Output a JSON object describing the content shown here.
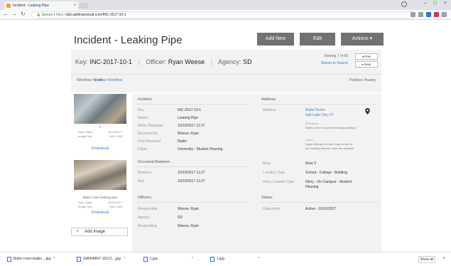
{
  "browser": {
    "tab_title": "Incident - Leaking Pipe",
    "url_secure": "Secure",
    "url_proto": "https://",
    "url": "ally.spillmancloud.com/INC-2017-10-1"
  },
  "page": {
    "title": "Incident - Leaking Pipe",
    "buttons": {
      "add_new": "Add New",
      "edit": "Edit",
      "actions": "Actions ▾"
    },
    "header": {
      "key_label": "Key:",
      "key_value": "INC-2017-10-1",
      "officer_label": "Officer:",
      "officer_value": "Ryan Weese",
      "agency_label": "Agency:",
      "agency_value": "SD",
      "viewing": "Viewing 7 of 66",
      "return": "Return to Search",
      "prev": "◂ Prev",
      "next": "▸ Next",
      "workflow_label": "Workflow:",
      "workflow_value": "None",
      "start_workflow": "Start Workflow",
      "partition": "Partition: Bradey"
    },
    "images": [
      {
        "caption": "1",
        "date_label": "Date Taken",
        "date": "10/10/2017",
        "size_label": "Image Size",
        "size": "600 x 480",
        "download": "Download"
      },
      {
        "caption": "Boiler room leaking pipe",
        "date_label": "Date Taken",
        "date": "10/10/2017",
        "size_label": "Image Size",
        "size": "500 x 360",
        "download": "Download"
      }
    ],
    "add_image": "Add Image",
    "incident": {
      "title": "Incident",
      "fields": [
        {
          "label": "Key",
          "value": "INC-2017-10-1"
        },
        {
          "label": "Nature",
          "value": "Leaking Pipe"
        },
        {
          "label": "When Reported",
          "value": "10/10/2017 11:27"
        },
        {
          "label": "Received By",
          "value": "Weese, Ryan"
        },
        {
          "label": "How Received",
          "value": "Radio"
        },
        {
          "label": "Client",
          "value": "University - Student Housing"
        }
      ]
    },
    "occurred": {
      "title": "Occurred Between",
      "fields": [
        {
          "label": "Between",
          "value": "10/10/2017 11:27"
        },
        {
          "label": "And",
          "value": "10/10/2017 11:27"
        }
      ]
    },
    "officers": {
      "title": "Officers",
      "fields": [
        {
          "label": "Responsible",
          "value": "Weese, Ryan"
        },
        {
          "label": "Agency",
          "value": "SD"
        },
        {
          "label": "Responding",
          "value": "Weese, Ryan"
        }
      ]
    },
    "address": {
      "title": "Address",
      "address_label": "Address",
      "address_line1": "Boiler Room",
      "address_line2": "Salt Lake City, UT",
      "directions_label": "Directions",
      "directions": "Boiler room in student housing building 3",
      "notes_label": "Notes",
      "notes_line1": "Upper left pipe in north east corner of",
      "notes_line2": "the building directly under the stairwell",
      "area_label": "Area",
      "area": "Area 3",
      "location_type_label": "Location Type",
      "location_type": "School - College - Building",
      "glory_label": "Glory Location Type",
      "glory_line1": "Glory - On-Campus - Student",
      "glory_line2": "Housing"
    },
    "status": {
      "title": "Status",
      "disposition_label": "Disposition",
      "disposition": "Active - 10/10/2017"
    }
  },
  "downloads": {
    "items": [
      "Boiler room leakin....jpg",
      "2d8998897-19121....jpg",
      "1.jpg",
      "1.jpg"
    ],
    "show_all": "Show all"
  }
}
